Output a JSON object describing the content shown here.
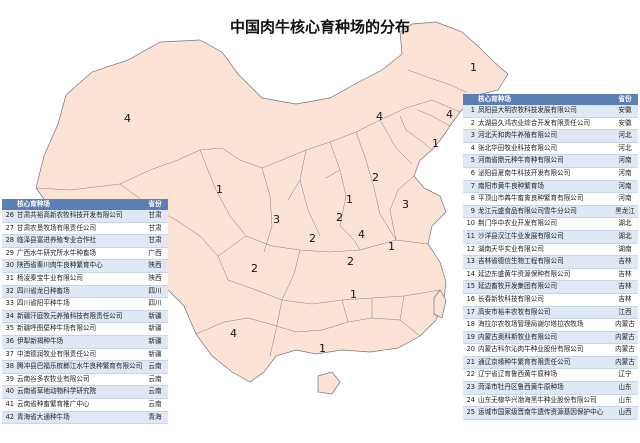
{
  "title": "中国肉牛核心育种场的分布",
  "map": {
    "region_counts": [
      {
        "region": "黑龙江",
        "value": "1"
      },
      {
        "region": "新疆",
        "value": "4"
      },
      {
        "region": "内蒙古",
        "value": "4"
      },
      {
        "region": "吉林",
        "value": "4"
      },
      {
        "region": "辽宁",
        "value": "1"
      },
      {
        "region": "河北",
        "value": "2"
      },
      {
        "region": "甘肃",
        "value": "1"
      },
      {
        "region": "宁夏",
        "value": "3"
      },
      {
        "region": "陕西",
        "value": "1"
      },
      {
        "region": "山西",
        "value": "2"
      },
      {
        "region": "山东",
        "value": "3"
      },
      {
        "region": "河南",
        "value": "4"
      },
      {
        "region": "四川",
        "value": "2"
      },
      {
        "region": "青海",
        "value": "2"
      },
      {
        "region": "湖北",
        "value": "2"
      },
      {
        "region": "安徽",
        "value": "1"
      },
      {
        "region": "云南",
        "value": "4"
      },
      {
        "region": "湖南",
        "value": "1"
      },
      {
        "region": "广西",
        "value": "1"
      }
    ]
  },
  "table_right": {
    "headers": {
      "name": "核心育种场",
      "prov": "省份"
    },
    "rows": [
      {
        "no": "1",
        "name": "凤阳县大明农牧科技发展有限公司",
        "prov": "安徽"
      },
      {
        "no": "2",
        "name": "太湖县久鸿农业综合开发有限责任公司",
        "prov": "安徽"
      },
      {
        "no": "3",
        "name": "河北天和肉牛养殖有限公司",
        "prov": "河北"
      },
      {
        "no": "4",
        "name": "张北华田牧业科技有限公司",
        "prov": "河北"
      },
      {
        "no": "5",
        "name": "河南省鼎元种牛育种有限公司",
        "prov": "河南"
      },
      {
        "no": "6",
        "name": "泌阳县夏南牛科技开发有限公司",
        "prov": "河南"
      },
      {
        "no": "7",
        "name": "南阳市黄牛良种繁育场",
        "prov": "河南"
      },
      {
        "no": "8",
        "name": "平顶山市羴牛畜禽良种繁育有限公司",
        "prov": "河南"
      },
      {
        "no": "9",
        "name": "龙江元盛食品有限公司雪牛分公司",
        "prov": "黑龙江"
      },
      {
        "no": "10",
        "name": "荆门华中农业开发有限公司",
        "prov": "湖北"
      },
      {
        "no": "11",
        "name": "沙洋县汉江牛业发展有限公司",
        "prov": "湖北"
      },
      {
        "no": "12",
        "name": "湖南天华实业有限公司",
        "prov": "湖南"
      },
      {
        "no": "13",
        "name": "吉林省德信生物工程有限公司",
        "prov": "吉林"
      },
      {
        "no": "14",
        "name": "延边东盛黄牛资源保种有限公司",
        "prov": "吉林"
      },
      {
        "no": "15",
        "name": "延边畜牧开发集团有限公司",
        "prov": "吉林"
      },
      {
        "no": "16",
        "name": "长春新牧科技有限公司",
        "prov": "吉林"
      },
      {
        "no": "17",
        "name": "高安市裕丰农牧有限公司",
        "prov": "江西"
      },
      {
        "no": "18",
        "name": "海拉尔农牧场管理局谢尔塔拉农牧场",
        "prov": "内蒙古"
      },
      {
        "no": "19",
        "name": "内蒙古奥科斯牧业有限公司",
        "prov": "内蒙古"
      },
      {
        "no": "20",
        "name": "内蒙古科尔沁肉牛种业股份有限公司",
        "prov": "内蒙古"
      },
      {
        "no": "21",
        "name": "通辽京缘种牛繁育有限责任公司",
        "prov": "内蒙古"
      },
      {
        "no": "22",
        "name": "辽宁省辽育鲁西黄牛原种场",
        "prov": "辽宁"
      },
      {
        "no": "23",
        "name": "菏泽市牡丹区鲁西黄牛原种场",
        "prov": "山东"
      },
      {
        "no": "24",
        "name": "山东无棣华兴渤海黑牛种业股份有限公司",
        "prov": "山东"
      },
      {
        "no": "25",
        "name": "运城市国家级晋南牛遗传资源基因保护中心",
        "prov": "山西"
      }
    ]
  },
  "table_left": {
    "headers": {
      "name": "核心育种场",
      "prov": "省份"
    },
    "rows": [
      {
        "no": "26",
        "name": "甘肃共裕高新农牧科技开发有限公司",
        "prov": "甘肃"
      },
      {
        "no": "27",
        "name": "甘肃农垦牧场有限责任公司",
        "prov": "甘肃"
      },
      {
        "no": "28",
        "name": "临泽县富进养殖专业合作社",
        "prov": "甘肃"
      },
      {
        "no": "29",
        "name": "广西水牛研究所水牛种畜场",
        "prov": "广西"
      },
      {
        "no": "30",
        "name": "陕西省秦川肉牛良种繁育中心",
        "prov": "陕西"
      },
      {
        "no": "31",
        "name": "杨凌秦宝牛业有限公司",
        "prov": "陕西"
      },
      {
        "no": "32",
        "name": "四川省龙日种畜场",
        "prov": "四川"
      },
      {
        "no": "33",
        "name": "四川省阳平种牛场",
        "prov": "四川"
      },
      {
        "no": "34",
        "name": "新疆汗庭牧元养殖科技有限责任公司",
        "prov": "新疆"
      },
      {
        "no": "35",
        "name": "新疆呼图壁种牛场有限公司",
        "prov": "新疆"
      },
      {
        "no": "36",
        "name": "伊犁新褐种牛场",
        "prov": "新疆"
      },
      {
        "no": "37",
        "name": "中澳德润牧业有限责任公司",
        "prov": "新疆"
      },
      {
        "no": "38",
        "name": "腾冲县巴福乐槟榔江水牛良种繁育有限公司",
        "prov": "云南"
      },
      {
        "no": "39",
        "name": "云南谷多农牧业有限公司",
        "prov": "云南"
      },
      {
        "no": "40",
        "name": "云南省草地动物科学研究院",
        "prov": "云南"
      },
      {
        "no": "41",
        "name": "云南省种畜繁育推广中心",
        "prov": "云南"
      },
      {
        "no": "42",
        "name": "青海省大通种牛场",
        "prov": "青海"
      }
    ]
  }
}
